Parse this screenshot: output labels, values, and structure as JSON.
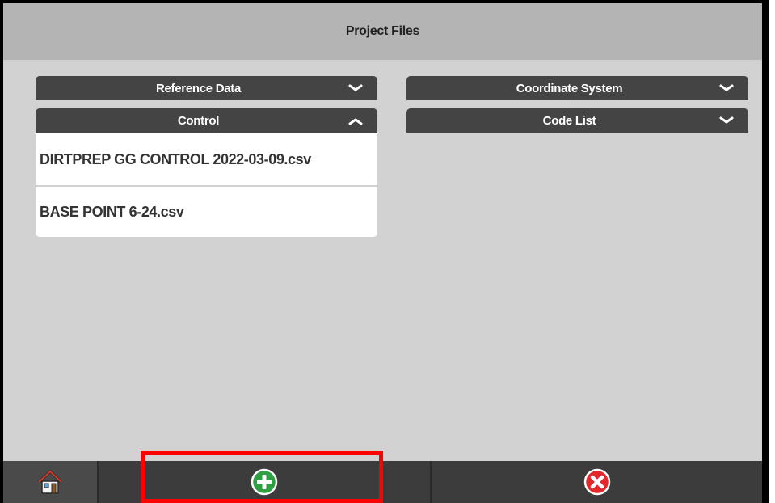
{
  "window": {
    "title": "Project Files"
  },
  "left_column": {
    "sections": [
      {
        "label": "Reference Data",
        "state": "collapsed",
        "chevron": "chevron-down-icon"
      },
      {
        "label": "Control",
        "state": "expanded",
        "chevron": "chevron-up-icon",
        "files": [
          {
            "name": "DIRTPREP GG CONTROL 2022-03-09.csv"
          },
          {
            "name": "BASE POINT 6-24.csv"
          }
        ]
      }
    ]
  },
  "right_column": {
    "sections": [
      {
        "label": "Coordinate System",
        "state": "collapsed",
        "chevron": "chevron-down-icon"
      },
      {
        "label": "Code List",
        "state": "collapsed",
        "chevron": "chevron-down-icon"
      }
    ]
  },
  "bottom_bar": {
    "home_icon": "home-icon",
    "add_icon": "add-icon",
    "cancel_icon": "cancel-icon"
  },
  "colors": {
    "title_bar": "#b4b4b4",
    "body": "#d2d2d2",
    "section_header": "#444444",
    "bottom_bar": "#3c3c3c",
    "add_green": "#2ea043",
    "cancel_red": "#e0282d",
    "highlight": "#ff0000"
  }
}
